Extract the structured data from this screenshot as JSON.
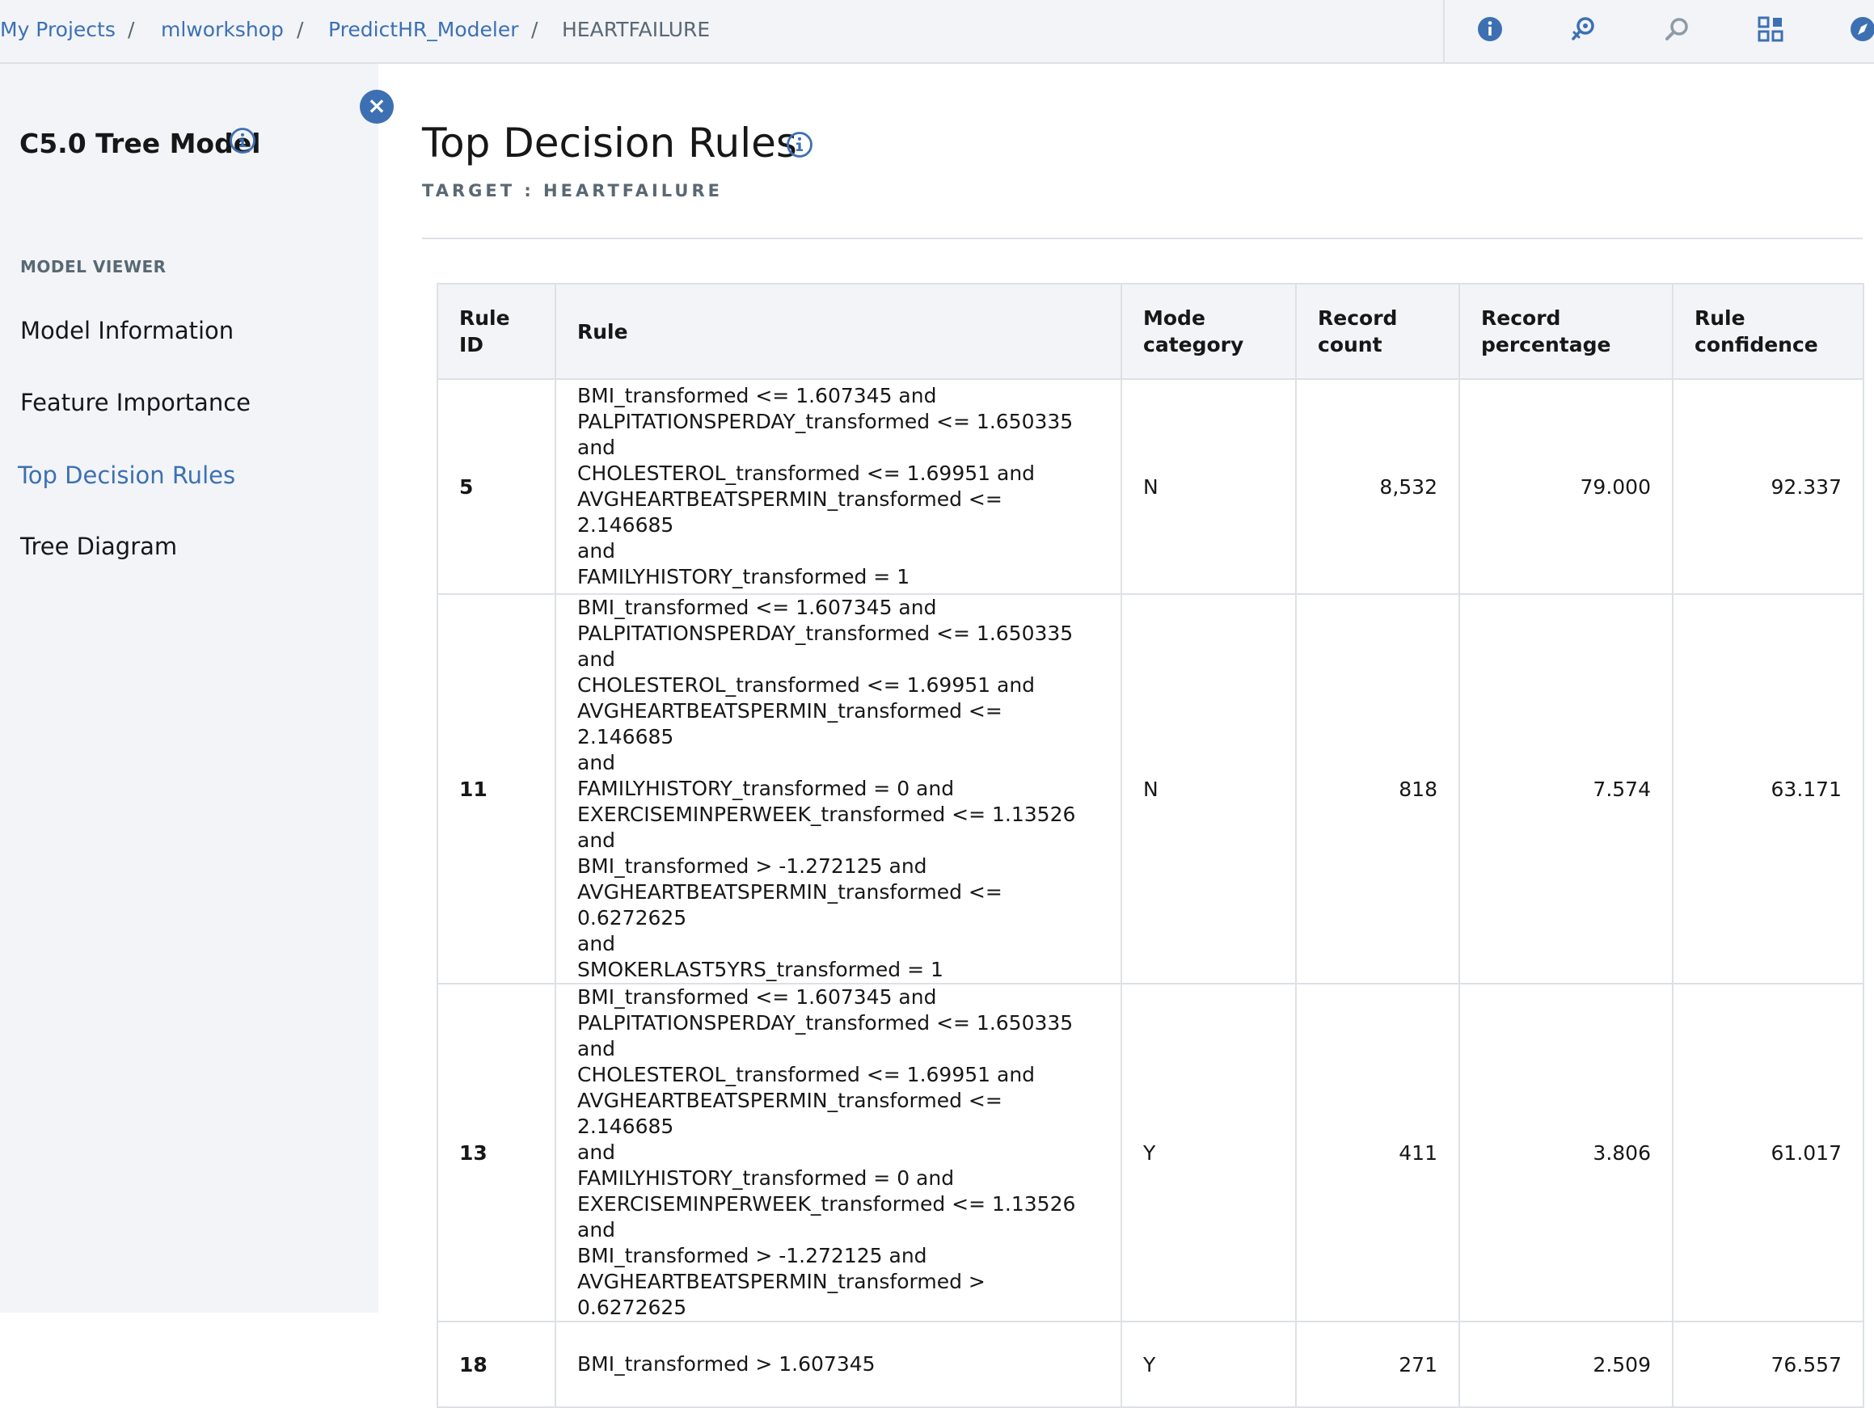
{
  "breadcrumb": {
    "items": [
      "My Projects",
      "mlworkshop",
      "PredictHR_Modeler",
      "HEARTFAILURE"
    ],
    "separator": "/"
  },
  "toolbar": {
    "icons": [
      "info-icon",
      "deploy-icon",
      "search-icon",
      "grid-icon",
      "compass-icon"
    ]
  },
  "sidebar": {
    "close_label": "×",
    "model_title": "C5.0 Tree Model",
    "section_label": "MODEL VIEWER",
    "items": [
      {
        "label": "Model Information"
      },
      {
        "label": "Feature Importance"
      },
      {
        "label": "Top Decision Rules"
      },
      {
        "label": "Tree Diagram"
      }
    ],
    "active_index": 2
  },
  "main": {
    "title": "Top Decision Rules",
    "subtitle": "TARGET : HEARTFAILURE"
  },
  "table": {
    "headers": [
      "Rule ID",
      "Rule",
      "Mode category",
      "Record count",
      "Record percentage",
      "Rule confidence"
    ],
    "rows": [
      {
        "id": "5",
        "rule": "BMI_transformed <= 1.607345 and\nPALPITATIONSPERDAY_transformed <= 1.650335 and\nCHOLESTEROL_transformed <= 1.69951 and\nAVGHEARTBEATSPERMIN_transformed <= 2.146685\nand\nFAMILYHISTORY_transformed = 1",
        "mode": "N",
        "count": "8,532",
        "percentage": "79.000",
        "confidence": "92.337"
      },
      {
        "id": "11",
        "rule": "BMI_transformed <= 1.607345 and\nPALPITATIONSPERDAY_transformed <= 1.650335 and\nCHOLESTEROL_transformed <= 1.69951 and\nAVGHEARTBEATSPERMIN_transformed <= 2.146685\nand\nFAMILYHISTORY_transformed = 0 and\nEXERCISEMINPERWEEK_transformed <= 1.13526 and\nBMI_transformed > -1.272125 and\nAVGHEARTBEATSPERMIN_transformed <= 0.6272625\nand\nSMOKERLAST5YRS_transformed = 1",
        "mode": "N",
        "count": "818",
        "percentage": "7.574",
        "confidence": "63.171"
      },
      {
        "id": "13",
        "rule": "BMI_transformed <= 1.607345 and\nPALPITATIONSPERDAY_transformed <= 1.650335 and\nCHOLESTEROL_transformed <= 1.69951 and\nAVGHEARTBEATSPERMIN_transformed <= 2.146685\nand\nFAMILYHISTORY_transformed = 0 and\nEXERCISEMINPERWEEK_transformed <= 1.13526 and\nBMI_transformed > -1.272125 and\nAVGHEARTBEATSPERMIN_transformed > 0.6272625",
        "mode": "Y",
        "count": "411",
        "percentage": "3.806",
        "confidence": "61.017"
      },
      {
        "id": "18",
        "rule": "BMI_transformed > 1.607345",
        "mode": "Y",
        "count": "271",
        "percentage": "2.509",
        "confidence": "76.557"
      }
    ]
  },
  "colors": {
    "accent": "#3d70b2",
    "sidebar_bg": "#f2f4f8",
    "border": "#dde1e6",
    "muted_text": "#5a6872"
  }
}
